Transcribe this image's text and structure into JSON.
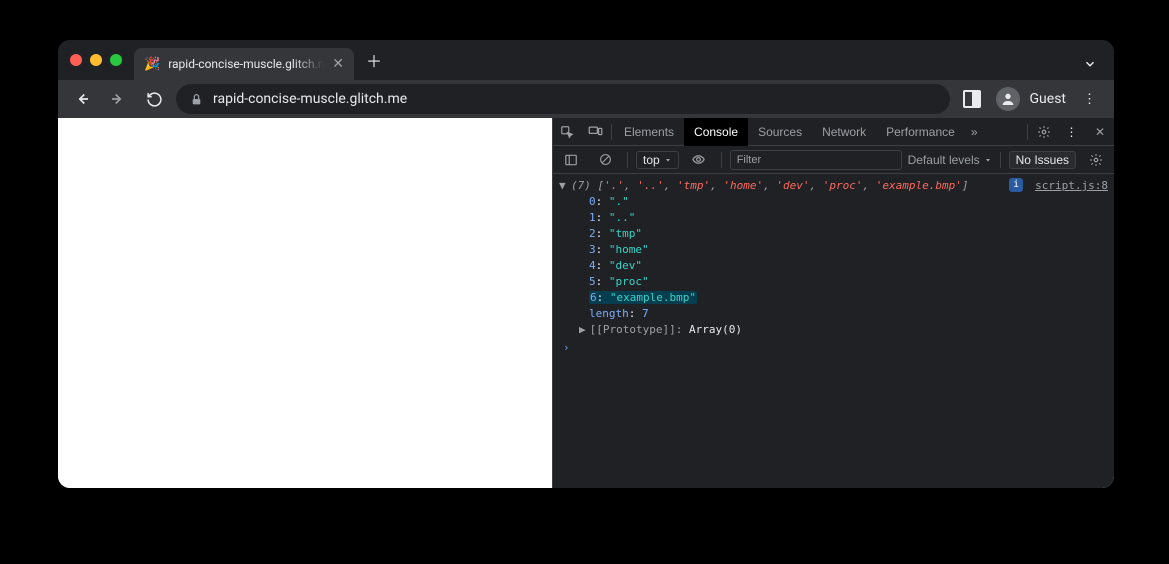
{
  "browser": {
    "tab_title": "rapid-concise-muscle.glitch.me",
    "url": "rapid-concise-muscle.glitch.me",
    "guest_label": "Guest"
  },
  "devtools": {
    "tabs": {
      "elements": "Elements",
      "console": "Console",
      "sources": "Sources",
      "network": "Network",
      "performance": "Performance"
    },
    "console_toolbar": {
      "context": "top",
      "filter_placeholder": "Filter",
      "levels_label": "Default levels",
      "issues_label": "No Issues"
    },
    "log": {
      "count": "(7)",
      "summary_items": [
        "'.'",
        "'..'",
        "'tmp'",
        "'home'",
        "'dev'",
        "'proc'",
        "'example.bmp'"
      ],
      "source_link": "script.js:8",
      "entries": [
        {
          "index": "0",
          "value": "\".\""
        },
        {
          "index": "1",
          "value": "\"..\""
        },
        {
          "index": "2",
          "value": "\"tmp\""
        },
        {
          "index": "3",
          "value": "\"home\""
        },
        {
          "index": "4",
          "value": "\"dev\""
        },
        {
          "index": "5",
          "value": "\"proc\""
        },
        {
          "index": "6",
          "value": "\"example.bmp\"",
          "highlight": true
        }
      ],
      "length_label": "length",
      "length_value": "7",
      "proto_label": "[[Prototype]]",
      "proto_value": "Array(0)"
    }
  }
}
